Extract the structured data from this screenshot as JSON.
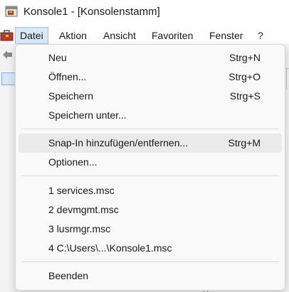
{
  "window": {
    "title": "Konsole1 - [Konsolenstamm]"
  },
  "menubar": {
    "items": [
      {
        "label": "Datei",
        "active": true
      },
      {
        "label": "Aktion"
      },
      {
        "label": "Ansicht"
      },
      {
        "label": "Favoriten"
      },
      {
        "label": "Fenster"
      },
      {
        "label": "?"
      }
    ]
  },
  "file_menu": {
    "items": [
      {
        "label": "Neu",
        "shortcut": "Strg+N"
      },
      {
        "label": "Öffnen...",
        "shortcut": "Strg+O"
      },
      {
        "label": "Speichern",
        "shortcut": "Strg+S"
      },
      {
        "label": "Speichern unter...",
        "shortcut": ""
      },
      {
        "label": "Snap-In hinzufügen/entfernen...",
        "shortcut": "Strg+M",
        "highlighted": true
      },
      {
        "label": "Optionen...",
        "shortcut": ""
      },
      {
        "label": "1 services.msc",
        "shortcut": ""
      },
      {
        "label": "2 devmgmt.msc",
        "shortcut": ""
      },
      {
        "label": "3 lusrmgr.msc",
        "shortcut": ""
      },
      {
        "label": "4 C:\\Users\\...\\Konsole1.msc",
        "shortcut": ""
      },
      {
        "label": "Beenden",
        "shortcut": ""
      }
    ]
  },
  "icons": {
    "app": "mmc-console-icon",
    "menubar": "console-toolbox-icon",
    "back": "back-arrow-icon",
    "tree": "folder-icon"
  },
  "colors": {
    "menu_active_bg": "#dbe9f7",
    "menu_active_border": "#9cc4ea",
    "dropdown_bg": "#f9f9f9",
    "hover_bg": "#eaeaea"
  }
}
